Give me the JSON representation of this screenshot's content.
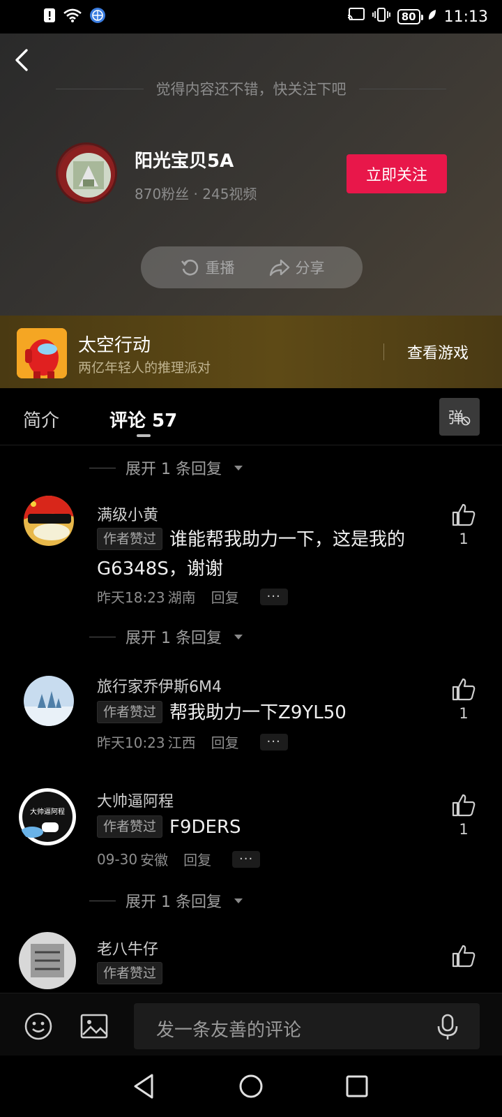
{
  "status_bar": {
    "time": "11:13",
    "battery": "80"
  },
  "end_panel": {
    "follow_hint": "觉得内容还不错，快关注下吧",
    "author_name": "阳光宝贝5A",
    "author_stats": "870粉丝 · 245视频",
    "follow_button": "立即关注",
    "replay_label": "重播",
    "share_label": "分享"
  },
  "game_banner": {
    "title": "太空行动",
    "subtitle": "两亿年轻人的推理派对",
    "link": "查看游戏"
  },
  "tabs": {
    "intro": "简介",
    "comments": "评论 57",
    "danmaku": "弹"
  },
  "comments": {
    "expand_reply": "展开 1 条回复",
    "author_liked_badge": "作者赞过",
    "reply_label": "回复",
    "more_label": "···",
    "items": [
      {
        "user": "满级小黄",
        "text": "谁能帮我助力一下，这是我的G6348S，谢谢",
        "time": "昨天18:23",
        "region": "湖南",
        "likes": "1"
      },
      {
        "user": "旅行家乔伊斯6M4",
        "text": "帮我助力一下Z9YL50",
        "time": "昨天10:23",
        "region": "江西",
        "likes": "1"
      },
      {
        "user": "大帅逼阿程",
        "text": "F9DERS",
        "time": "09-30",
        "region": "安徽",
        "likes": "1",
        "avatar_text": "大帅逼阿程"
      },
      {
        "user": "老八牛仔",
        "text": "",
        "time": "",
        "region": "",
        "likes": ""
      }
    ]
  },
  "input_bar": {
    "placeholder": "发一条友善的评论"
  }
}
